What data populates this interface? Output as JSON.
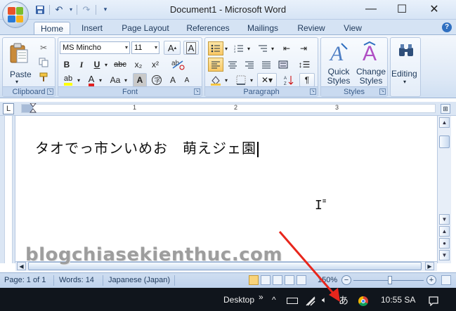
{
  "window": {
    "title": "Document1 - Microsoft Word",
    "minimize": "—",
    "maximize": "☐",
    "close": "✕"
  },
  "qat": {
    "save_icon": "save-icon",
    "undo_icon": "undo-icon",
    "redo_icon": "redo-icon",
    "customize_icon": "customize-icon"
  },
  "tabs": [
    {
      "label": "Home"
    },
    {
      "label": "Insert"
    },
    {
      "label": "Page Layout"
    },
    {
      "label": "References"
    },
    {
      "label": "Mailings"
    },
    {
      "label": "Review"
    },
    {
      "label": "View"
    }
  ],
  "help": "?",
  "ribbon": {
    "clipboard": {
      "paste_label": "Paste",
      "group_label": "Clipboard"
    },
    "font": {
      "font_name": "MS Mincho",
      "font_size": "11",
      "bold": "B",
      "italic": "I",
      "underline": "U",
      "strikethrough": "abc",
      "subscript": "x₂",
      "superscript": "x²",
      "change_case": "Aa",
      "grow": "A",
      "shrink": "A",
      "clear_format": "A",
      "shade": "A",
      "group_label": "Font"
    },
    "paragraph": {
      "group_label": "Paragraph",
      "show_marks": "¶"
    },
    "styles": {
      "quick_styles": "Quick Styles",
      "change_styles": "Change Styles",
      "group_label": "Styles"
    },
    "editing": {
      "label": "Editing"
    }
  },
  "ruler": {
    "tab_selector": "L",
    "numbers": [
      "1",
      "2",
      "3"
    ]
  },
  "document": {
    "text": "タオでっ市ンいめお　萌えジェ園"
  },
  "watermark": "blogchiasekienthuc.com",
  "status": {
    "page": "Page: 1 of 1",
    "words": "Words: 14",
    "language": "Japanese (Japan)",
    "zoom": "150%",
    "zoom_minus": "−",
    "zoom_plus": "+",
    "zoom_level_fraction": 0.52
  },
  "taskbar": {
    "desktop": "Desktop",
    "chevrons": "»",
    "up_arrow": "^",
    "ime": "あ",
    "time": "10:55 SA"
  },
  "colors": {
    "accent": "#2f6fc0",
    "arrow": "#e8261c"
  }
}
